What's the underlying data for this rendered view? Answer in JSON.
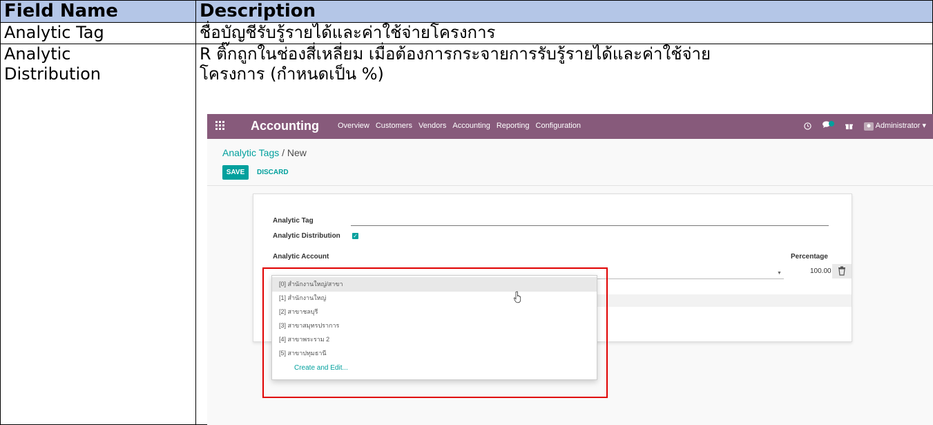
{
  "table": {
    "headers": [
      "Field Name",
      "Description"
    ],
    "rows": [
      {
        "field": "Analytic Tag",
        "description": "ชื่อบัญชีรับรู้รายได้และค่าใช้จ่ายโครงการ"
      },
      {
        "field_line1": "Analytic",
        "field_line2": "Distribution",
        "description_line1": "R ติ๊กถูกในช่องสี่เหลี่ยม เมื่อต้องการกระจายการรับรู้รายได้และค่าใช้จ่าย",
        "description_line2": "โครงการ (กำหนดเป็น %)"
      }
    ]
  },
  "screenshot": {
    "app_name": "Accounting",
    "menu": [
      "Overview",
      "Customers",
      "Vendors",
      "Accounting",
      "Reporting",
      "Configuration"
    ],
    "user": "Administrator",
    "breadcrumb_link": "Analytic Tags",
    "breadcrumb_sep": " / ",
    "breadcrumb_current": "New",
    "save_label": "SAVE",
    "discard_label": "DISCARD",
    "form": {
      "analytic_tag_label": "Analytic Tag",
      "analytic_distribution_label": "Analytic Distribution",
      "analytic_distribution_checked": true,
      "analytic_account_header": "Analytic Account",
      "percentage_header": "Percentage",
      "percentage_value": "100.00"
    },
    "dropdown": {
      "options": [
        "[0] สำนักงานใหญ่/สาขา",
        "[1] สำนักงานใหญ่",
        "[2] สาขาชลบุรี",
        "[3] สาขาสมุทรปราการ",
        "[4] สาขาพระราม 2",
        "[5] สาขาปทุมธานี"
      ],
      "create_label": "Create and Edit..."
    },
    "colors": {
      "topbar": "#875a7b",
      "accent": "#00a09d",
      "highlight_box": "#e00000",
      "table_header": "#b4c6e7"
    }
  }
}
